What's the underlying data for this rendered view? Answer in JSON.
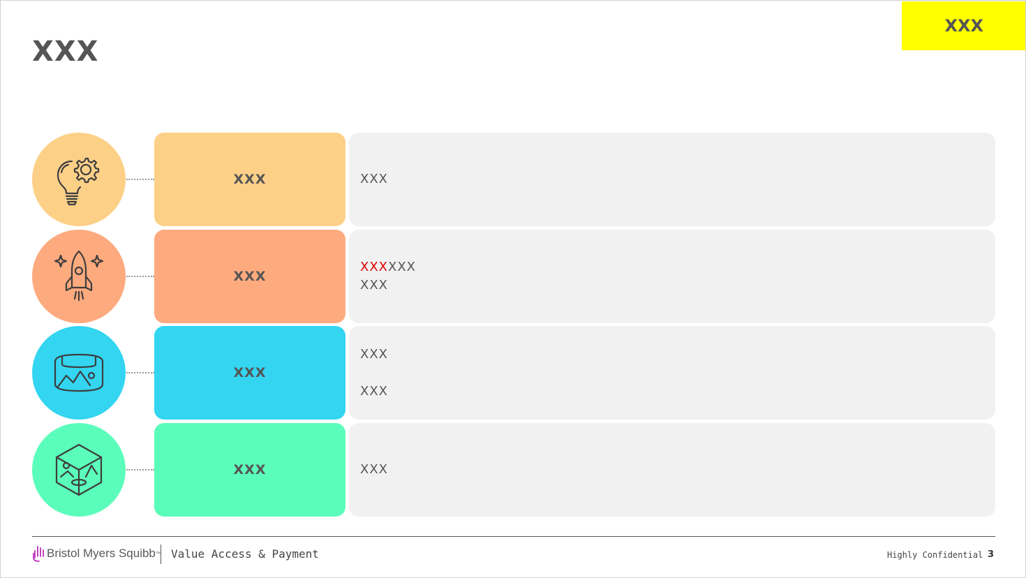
{
  "slide": {
    "title": "XXX",
    "tag": "XXX"
  },
  "rows": [
    {
      "icon": "lightbulb-gear-icon",
      "circle_color": "#fdd088",
      "label_color": "#fdd088",
      "label": "XXX",
      "lines": [
        "XXX"
      ]
    },
    {
      "icon": "rocket-icon",
      "circle_color": "#fdaa7e",
      "label_color": "#fdaa7e",
      "label": "XXX",
      "lines_highlight": "XXX",
      "lines_rest": "XXX",
      "line2": "XXX"
    },
    {
      "icon": "panorama-icon",
      "circle_color": "#33d5f1",
      "label_color": "#33d5f1",
      "label": "XXX",
      "line1": "XXX",
      "line2": "XXX"
    },
    {
      "icon": "cube-image-icon",
      "circle_color": "#5bfdba",
      "label_color": "#5bfdba",
      "label": "XXX",
      "line1": "XXX"
    }
  ],
  "footer": {
    "brand": "Bristol Myers Squibb",
    "brand_tm": "™",
    "department": "Value Access & Payment",
    "confidentiality": "Highly Confidential",
    "page_number": "3"
  },
  "colors": {
    "highlight_red": "#e00000",
    "tag_yellow": "#ffff00",
    "content_gray": "#f1f1f1",
    "text_gray": "#555555",
    "logo_purple": "#be2bbb"
  }
}
